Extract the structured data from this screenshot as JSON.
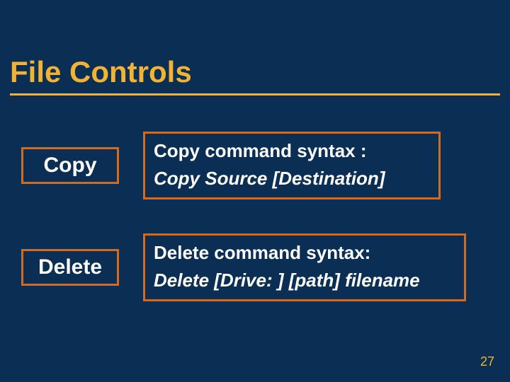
{
  "title": "File Controls",
  "copy": {
    "label": "Copy",
    "syntax_heading": "Copy command syntax :",
    "syntax_body": "Copy Source [Destination]"
  },
  "delete": {
    "label": "Delete",
    "syntax_heading": "Delete command syntax:",
    "syntax_body": "Delete [Drive: ] [path] filename"
  },
  "page_number": "27",
  "colors": {
    "background": "#0b2f54",
    "accent": "#f2b233",
    "box_border": "#d46a1f",
    "text": "#ffffff"
  }
}
